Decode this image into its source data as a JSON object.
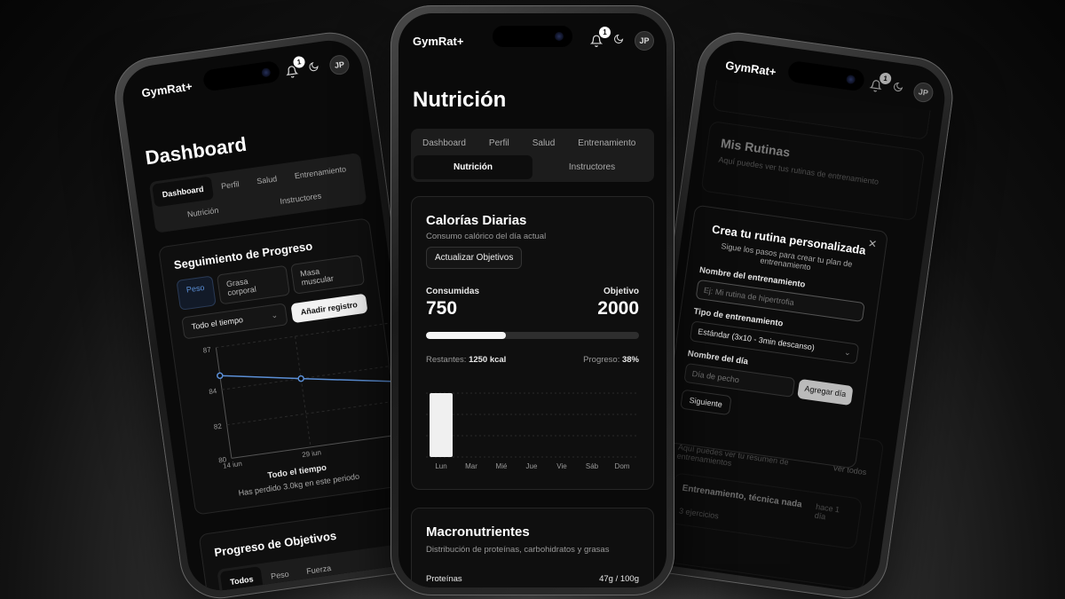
{
  "app_name": "GymRat+",
  "notifications_count": "1",
  "user_initials": "JP",
  "tabs_row1": [
    "Dashboard",
    "Perfil",
    "Salud",
    "Entrenamiento"
  ],
  "tabs_row2": [
    "Nutrición",
    "Instructores"
  ],
  "left": {
    "page_title": "Dashboard",
    "tabs_row1": [
      "Dashboard",
      "Perfil",
      "Salud",
      "Entrenamiento"
    ],
    "tabs_row2": [
      "Nutrición",
      "Instructores"
    ],
    "progress_card": {
      "title": "Seguimiento de Progreso",
      "metric_tabs": [
        "Peso",
        "Grasa corporal",
        "Masa muscular"
      ],
      "add_button": "Añadir registro",
      "period_select": "Todo el tiempo",
      "y_ticks": [
        "87",
        "84",
        "82",
        "80"
      ],
      "x_ticks": [
        "14 jun",
        "29 jun"
      ],
      "footer_title": "Todo el tiempo",
      "footer_sub": "Has perdido 3.0kg en este periodo"
    },
    "goals_card": {
      "title": "Progreso de Objetivos",
      "tabs": [
        "Todos",
        "Peso",
        "Fuerza"
      ]
    }
  },
  "center": {
    "page_title": "Nutrición",
    "calories": {
      "title": "Calorías Diarias",
      "subtitle": "Consumo calórico del día actual",
      "update_button": "Actualizar Objetivos",
      "consumed_label": "Consumidas",
      "consumed_value": "750",
      "goal_label": "Objetivo",
      "goal_value": "2000",
      "progress_fraction": 0.375,
      "remaining_label": "Restantes:",
      "remaining_value": "1250 kcal",
      "progress_label": "Progreso:",
      "progress_value": "38%",
      "days": [
        "Lun",
        "Mar",
        "Mié",
        "Jue",
        "Vie",
        "Sáb",
        "Dom"
      ]
    },
    "macros": {
      "title": "Macronutrientes",
      "subtitle": "Distribución de proteínas, carbohidratos y grasas",
      "first_item": "Proteínas",
      "first_value": "47g / 100g"
    }
  },
  "right": {
    "routines_title": "Mis Rutinas",
    "routines_sub": "Aquí puedes ver tus rutinas de entrenamiento",
    "dialog": {
      "title": "Crea tu rutina personalizada",
      "subtitle": "Sigue los pasos para crear tu plan de entrenamiento",
      "name_label": "Nombre del entrenamiento",
      "name_placeholder": "Ej: Mi rutina de hipertrofia",
      "type_label": "Tipo de entrenamiento",
      "type_value": "Estándar (3x10 - 3min descanso)",
      "day_label": "Nombre del día",
      "day_placeholder": "Día de pecho",
      "add_day_button": "Agregar día",
      "next_button": "Siguiente"
    },
    "history_title": "Historial",
    "history_sub": "Aquí puedes ver tu resumen de entrenamientos",
    "see_all": "Ver todos",
    "history_item_title": "Entrenamiento, técnica nada",
    "history_item_time": "hace 1 día",
    "history_item_meta": "3 ejercicios"
  },
  "colors": {
    "accent_blue": "#5b8fd6",
    "background": "#0a0a0a",
    "card": "#0f0f0f"
  },
  "icons": {
    "bell": "bell-icon",
    "moon": "moon-icon",
    "close": "close-icon",
    "chevron": "chevron-down-icon"
  }
}
